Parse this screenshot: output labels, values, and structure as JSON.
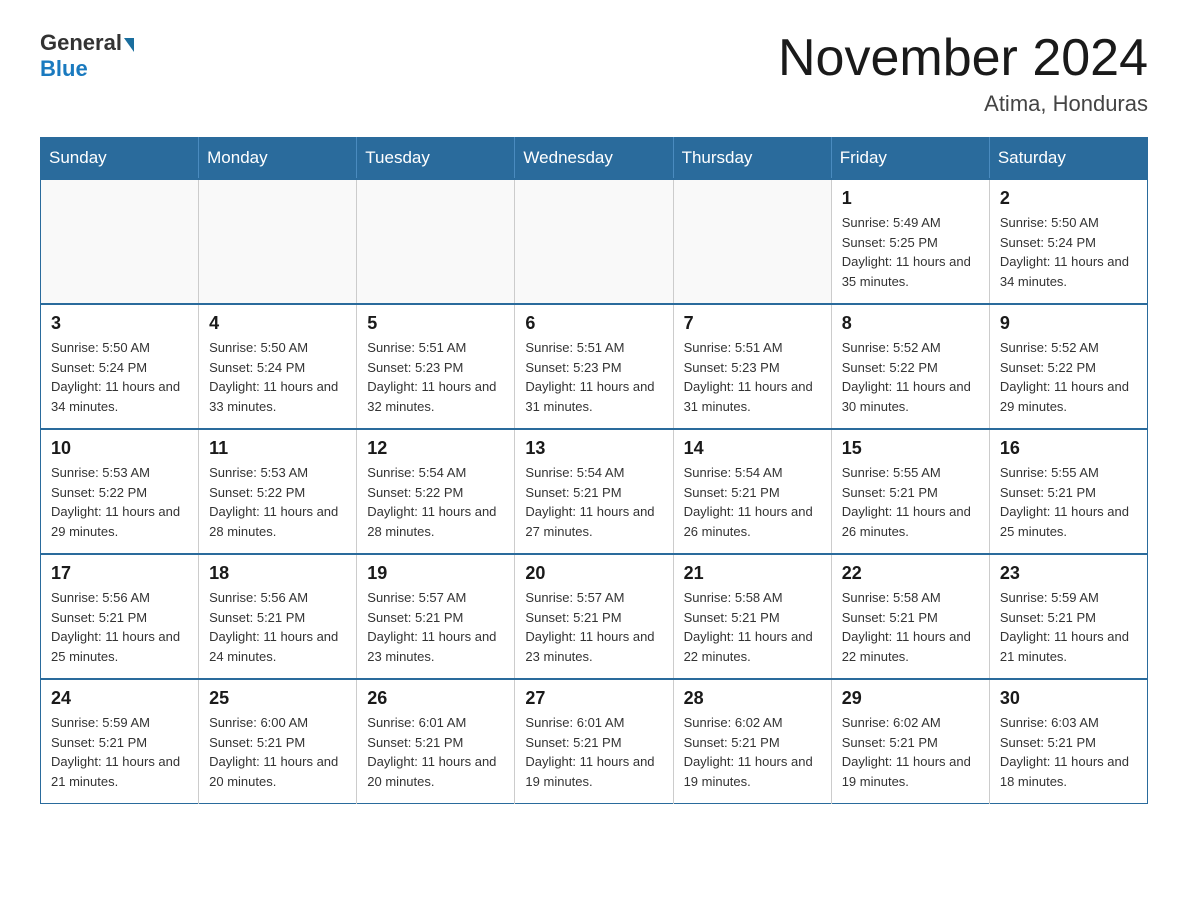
{
  "header": {
    "logo": {
      "general": "General",
      "blue": "Blue"
    },
    "title": "November 2024",
    "location": "Atima, Honduras"
  },
  "calendar": {
    "weekdays": [
      "Sunday",
      "Monday",
      "Tuesday",
      "Wednesday",
      "Thursday",
      "Friday",
      "Saturday"
    ],
    "weeks": [
      [
        {
          "day": "",
          "info": ""
        },
        {
          "day": "",
          "info": ""
        },
        {
          "day": "",
          "info": ""
        },
        {
          "day": "",
          "info": ""
        },
        {
          "day": "",
          "info": ""
        },
        {
          "day": "1",
          "info": "Sunrise: 5:49 AM\nSunset: 5:25 PM\nDaylight: 11 hours and 35 minutes."
        },
        {
          "day": "2",
          "info": "Sunrise: 5:50 AM\nSunset: 5:24 PM\nDaylight: 11 hours and 34 minutes."
        }
      ],
      [
        {
          "day": "3",
          "info": "Sunrise: 5:50 AM\nSunset: 5:24 PM\nDaylight: 11 hours and 34 minutes."
        },
        {
          "day": "4",
          "info": "Sunrise: 5:50 AM\nSunset: 5:24 PM\nDaylight: 11 hours and 33 minutes."
        },
        {
          "day": "5",
          "info": "Sunrise: 5:51 AM\nSunset: 5:23 PM\nDaylight: 11 hours and 32 minutes."
        },
        {
          "day": "6",
          "info": "Sunrise: 5:51 AM\nSunset: 5:23 PM\nDaylight: 11 hours and 31 minutes."
        },
        {
          "day": "7",
          "info": "Sunrise: 5:51 AM\nSunset: 5:23 PM\nDaylight: 11 hours and 31 minutes."
        },
        {
          "day": "8",
          "info": "Sunrise: 5:52 AM\nSunset: 5:22 PM\nDaylight: 11 hours and 30 minutes."
        },
        {
          "day": "9",
          "info": "Sunrise: 5:52 AM\nSunset: 5:22 PM\nDaylight: 11 hours and 29 minutes."
        }
      ],
      [
        {
          "day": "10",
          "info": "Sunrise: 5:53 AM\nSunset: 5:22 PM\nDaylight: 11 hours and 29 minutes."
        },
        {
          "day": "11",
          "info": "Sunrise: 5:53 AM\nSunset: 5:22 PM\nDaylight: 11 hours and 28 minutes."
        },
        {
          "day": "12",
          "info": "Sunrise: 5:54 AM\nSunset: 5:22 PM\nDaylight: 11 hours and 28 minutes."
        },
        {
          "day": "13",
          "info": "Sunrise: 5:54 AM\nSunset: 5:21 PM\nDaylight: 11 hours and 27 minutes."
        },
        {
          "day": "14",
          "info": "Sunrise: 5:54 AM\nSunset: 5:21 PM\nDaylight: 11 hours and 26 minutes."
        },
        {
          "day": "15",
          "info": "Sunrise: 5:55 AM\nSunset: 5:21 PM\nDaylight: 11 hours and 26 minutes."
        },
        {
          "day": "16",
          "info": "Sunrise: 5:55 AM\nSunset: 5:21 PM\nDaylight: 11 hours and 25 minutes."
        }
      ],
      [
        {
          "day": "17",
          "info": "Sunrise: 5:56 AM\nSunset: 5:21 PM\nDaylight: 11 hours and 25 minutes."
        },
        {
          "day": "18",
          "info": "Sunrise: 5:56 AM\nSunset: 5:21 PM\nDaylight: 11 hours and 24 minutes."
        },
        {
          "day": "19",
          "info": "Sunrise: 5:57 AM\nSunset: 5:21 PM\nDaylight: 11 hours and 23 minutes."
        },
        {
          "day": "20",
          "info": "Sunrise: 5:57 AM\nSunset: 5:21 PM\nDaylight: 11 hours and 23 minutes."
        },
        {
          "day": "21",
          "info": "Sunrise: 5:58 AM\nSunset: 5:21 PM\nDaylight: 11 hours and 22 minutes."
        },
        {
          "day": "22",
          "info": "Sunrise: 5:58 AM\nSunset: 5:21 PM\nDaylight: 11 hours and 22 minutes."
        },
        {
          "day": "23",
          "info": "Sunrise: 5:59 AM\nSunset: 5:21 PM\nDaylight: 11 hours and 21 minutes."
        }
      ],
      [
        {
          "day": "24",
          "info": "Sunrise: 5:59 AM\nSunset: 5:21 PM\nDaylight: 11 hours and 21 minutes."
        },
        {
          "day": "25",
          "info": "Sunrise: 6:00 AM\nSunset: 5:21 PM\nDaylight: 11 hours and 20 minutes."
        },
        {
          "day": "26",
          "info": "Sunrise: 6:01 AM\nSunset: 5:21 PM\nDaylight: 11 hours and 20 minutes."
        },
        {
          "day": "27",
          "info": "Sunrise: 6:01 AM\nSunset: 5:21 PM\nDaylight: 11 hours and 19 minutes."
        },
        {
          "day": "28",
          "info": "Sunrise: 6:02 AM\nSunset: 5:21 PM\nDaylight: 11 hours and 19 minutes."
        },
        {
          "day": "29",
          "info": "Sunrise: 6:02 AM\nSunset: 5:21 PM\nDaylight: 11 hours and 19 minutes."
        },
        {
          "day": "30",
          "info": "Sunrise: 6:03 AM\nSunset: 5:21 PM\nDaylight: 11 hours and 18 minutes."
        }
      ]
    ]
  }
}
